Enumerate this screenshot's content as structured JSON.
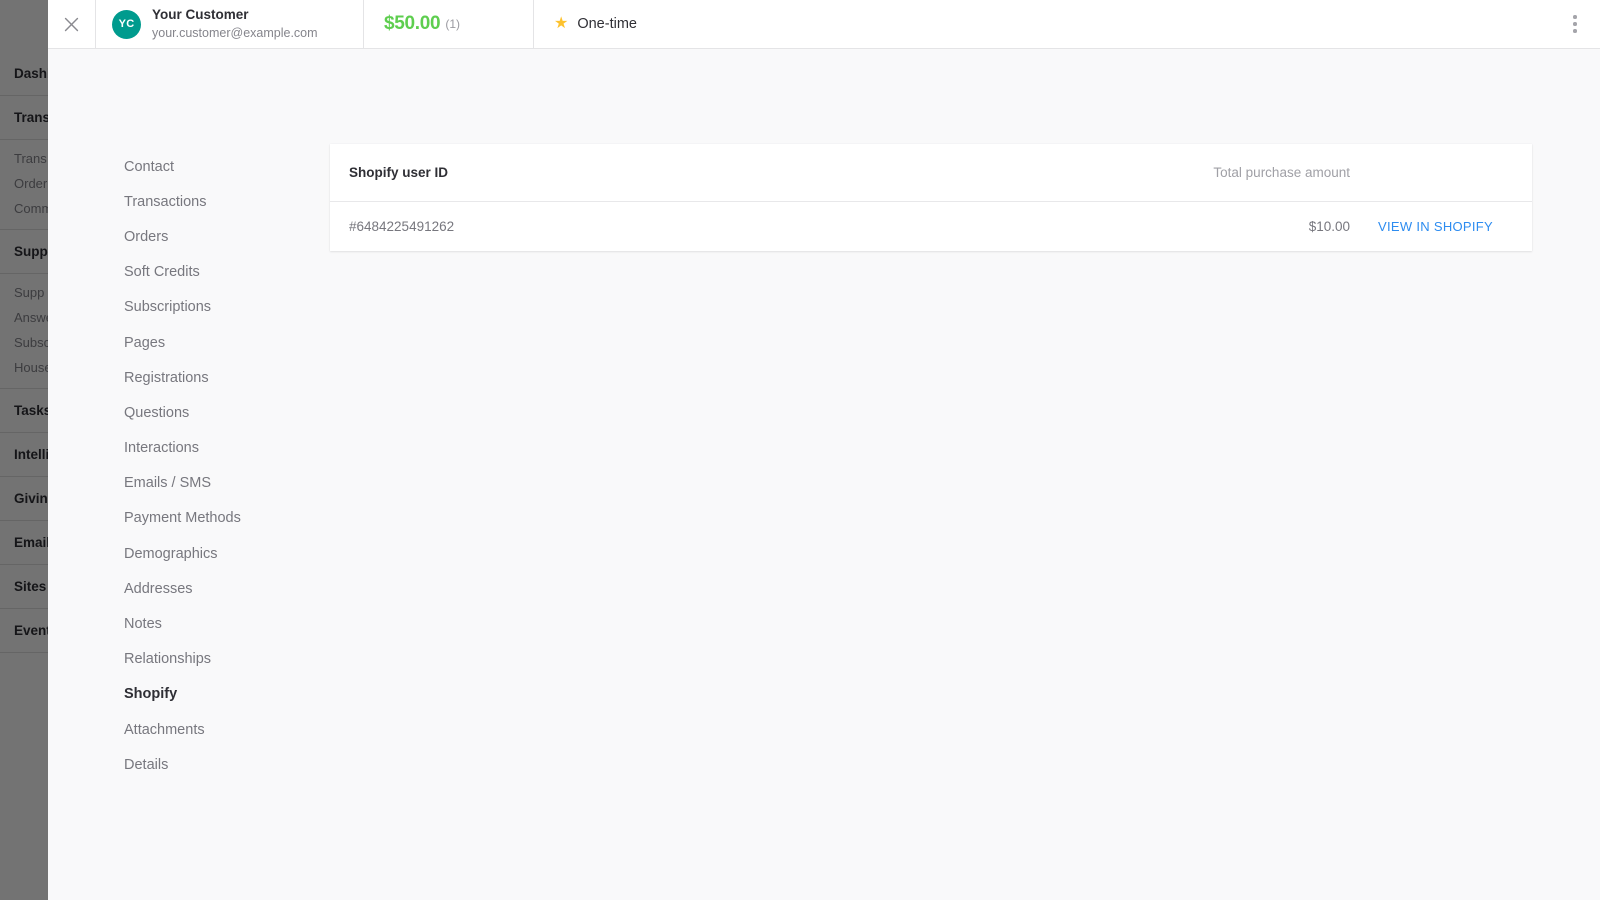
{
  "background_app": {
    "sidebar_groups": [
      {
        "primary": "Dashb",
        "subs": []
      },
      {
        "primary": "Trans",
        "subs": [
          "Trans",
          "Order",
          "Comm"
        ]
      },
      {
        "primary": "Suppo",
        "subs": [
          "Supp",
          "Answe",
          "Subsc",
          "House"
        ]
      },
      {
        "primary": "Tasks",
        "subs": []
      },
      {
        "primary": "Intelli",
        "subs": []
      },
      {
        "primary": "Giving",
        "subs": []
      },
      {
        "primary": "Email",
        "subs": []
      },
      {
        "primary": "Sites",
        "subs": []
      },
      {
        "primary": "Event",
        "subs": []
      }
    ]
  },
  "topbar": {
    "close_icon": "close-icon",
    "avatar_initials": "YC",
    "avatar_color": "#009b8e",
    "customer_name": "Your Customer",
    "customer_email": "your.customer@example.com",
    "amount": "$50.00",
    "amount_count": "(1)",
    "amount_color": "#5ece4f",
    "star_icon": "★",
    "star_color": "#fdc22e",
    "status_label": "One-time",
    "kebab_icon": "more-vertical-icon"
  },
  "section_nav": {
    "items": [
      {
        "label": "Contact",
        "active": false
      },
      {
        "label": "Transactions",
        "active": false
      },
      {
        "label": "Orders",
        "active": false
      },
      {
        "label": "Soft Credits",
        "active": false
      },
      {
        "label": "Subscriptions",
        "active": false
      },
      {
        "label": "Pages",
        "active": false
      },
      {
        "label": "Registrations",
        "active": false
      },
      {
        "label": "Questions",
        "active": false
      },
      {
        "label": "Interactions",
        "active": false
      },
      {
        "label": "Emails / SMS",
        "active": false
      },
      {
        "label": "Payment Methods",
        "active": false
      },
      {
        "label": "Demographics",
        "active": false
      },
      {
        "label": "Addresses",
        "active": false
      },
      {
        "label": "Notes",
        "active": false
      },
      {
        "label": "Relationships",
        "active": false
      },
      {
        "label": "Shopify",
        "active": true
      },
      {
        "label": "Attachments",
        "active": false
      },
      {
        "label": "Details",
        "active": false
      }
    ]
  },
  "shopify_table": {
    "headers": {
      "user_id": "Shopify user ID",
      "total_purchase_amount": "Total purchase amount"
    },
    "rows": [
      {
        "user_id": "#6484225491262",
        "amount": "$10.00",
        "action_label": "VIEW IN SHOPIFY",
        "action_color": "#2d8cf0"
      }
    ]
  }
}
